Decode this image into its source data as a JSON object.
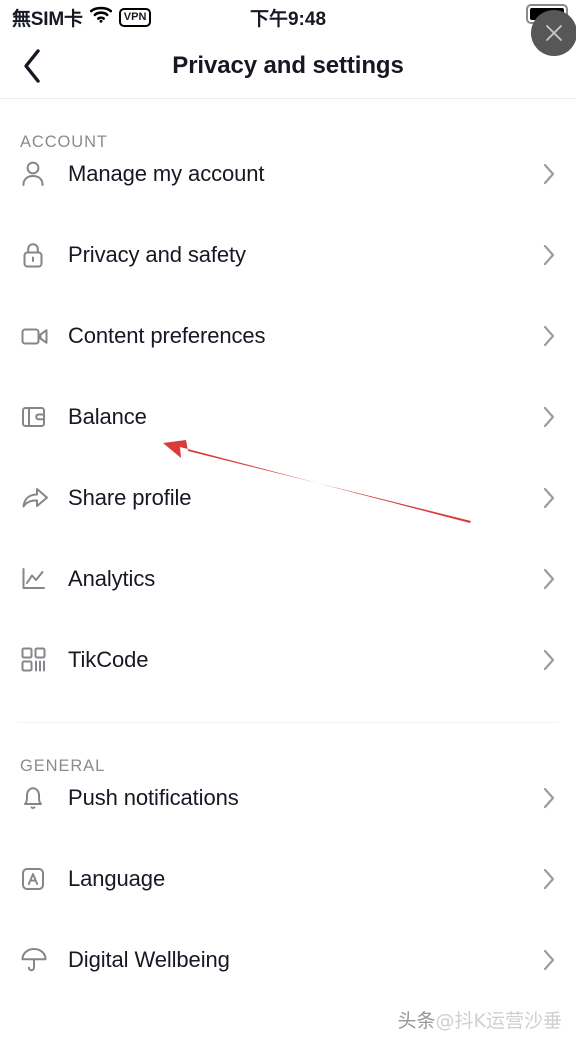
{
  "status_bar": {
    "carrier": "無SIM卡",
    "wifi_icon": "wifi-icon",
    "vpn_label": "VPN",
    "time": "下午9:48",
    "battery_icon": "battery-icon",
    "close_icon": "close-icon"
  },
  "header": {
    "back_icon": "chevron-left-icon",
    "title": "Privacy and settings"
  },
  "sections": [
    {
      "title": "ACCOUNT",
      "items": [
        {
          "label": "Manage my account",
          "icon": "person-icon",
          "chevron": "chevron-right-icon"
        },
        {
          "label": "Privacy and safety",
          "icon": "lock-icon",
          "chevron": "chevron-right-icon"
        },
        {
          "label": "Content preferences",
          "icon": "video-camera-icon",
          "chevron": "chevron-right-icon"
        },
        {
          "label": "Balance",
          "icon": "wallet-icon",
          "chevron": "chevron-right-icon"
        },
        {
          "label": "Share profile",
          "icon": "share-arrow-icon",
          "chevron": "chevron-right-icon"
        },
        {
          "label": "Analytics",
          "icon": "chart-line-icon",
          "chevron": "chevron-right-icon"
        },
        {
          "label": "TikCode",
          "icon": "qr-code-icon",
          "chevron": "chevron-right-icon"
        }
      ]
    },
    {
      "title": "GENERAL",
      "items": [
        {
          "label": "Push notifications",
          "icon": "bell-icon",
          "chevron": "chevron-right-icon"
        },
        {
          "label": "Language",
          "icon": "letter-a-box-icon",
          "chevron": "chevron-right-icon"
        },
        {
          "label": "Digital Wellbeing",
          "icon": "umbrella-icon",
          "chevron": "chevron-right-icon"
        }
      ]
    }
  ],
  "annotation": {
    "arrow_color": "#d93a3a",
    "points_at": "Balance"
  },
  "watermark": {
    "prefix": "头条",
    "handle": "@抖K运营沙垂"
  },
  "colors": {
    "text_primary": "#161823",
    "text_secondary": "#8a8b91",
    "divider": "#f2f2f3",
    "icon_stroke": "#85868b",
    "accent_red": "#d93a3a"
  }
}
